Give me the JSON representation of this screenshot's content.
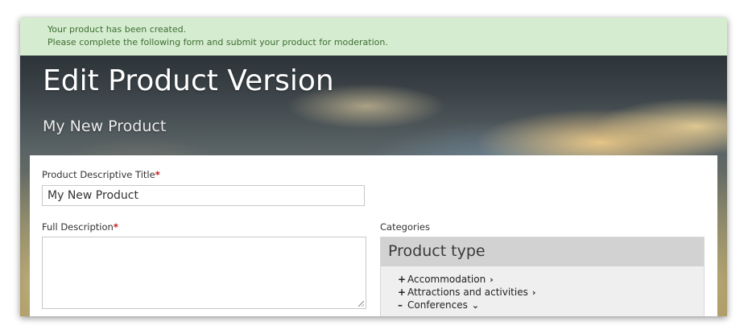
{
  "notice": {
    "line1": "Your product has been created.",
    "line2": "Please complete the following form and submit your product for moderation."
  },
  "header": {
    "title": "Edit Product Version",
    "subtitle": "My New Product"
  },
  "form": {
    "title_label": "Product Descriptive Title",
    "title_value": "My New Product",
    "description_label": "Full Description",
    "description_value": "",
    "required_mark": "*"
  },
  "categories": {
    "label": "Categories",
    "group_title": "Product type",
    "items": [
      {
        "symbol": "+",
        "label": "Accommodation",
        "chevron": "›"
      },
      {
        "symbol": "+",
        "label": "Attractions and activities",
        "chevron": "›"
      },
      {
        "symbol": "–",
        "label": "Conferences",
        "chevron": "⌄"
      }
    ]
  },
  "colors": {
    "notice_bg": "#d6ecd0",
    "notice_text": "#3c6e33",
    "required": "#cc1111",
    "category_header_bg": "#d2d2d2"
  }
}
